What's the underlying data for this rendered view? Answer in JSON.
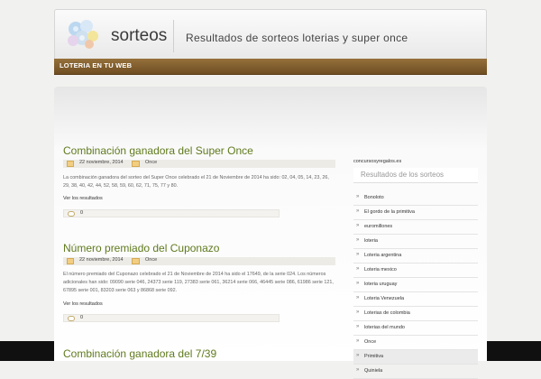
{
  "header": {
    "site_name": "sorteos",
    "tagline": "Resultados de sorteos loterias y super once"
  },
  "nav": {
    "items": [
      "LOTERIA EN TU WEB"
    ]
  },
  "posts": [
    {
      "title": "Combinación ganadora del Super Once",
      "date": "22 noviembre, 2014",
      "category": "Once",
      "excerpt": "La combinación ganadora del sorteo del Super Once celebrado el 21 de Noviembre de 2014 ha sido: 02, 04, 05, 14, 23, 26, 29, 38, 40, 42, 44, 52, 58, 59, 60, 62, 71, 75, 77 y 80.",
      "more": "Ver los resultados",
      "comments": "0"
    },
    {
      "title": "Número premiado del Cuponazo",
      "date": "22 noviembre, 2014",
      "category": "Once",
      "excerpt": "El número premiado del Cuponazo celebrado el 21 de Noviembre de 2014 ha sido el 17649, de la serie 024. Los números adicionales han sido: 09090 serie 046, 24373 serie 119, 27383 serie 061, 36214 serie 066, 46445 serie 086, 61986 serie 121, 67895 serie 001, 83203 serie 063 y 86868 serie 092.",
      "more": "Ver los resultados",
      "comments": "0"
    },
    {
      "title": "Combinación ganadora del 7/39"
    }
  ],
  "sidebar": {
    "note": "concursosyregalos.es",
    "heading": "Resultados de los sorteos",
    "items": [
      "Bonoloto",
      "El gordo de la primitiva",
      "euromillones",
      "loteria",
      "Loteria argentina",
      "Loteria mexico",
      "loteria uruguay",
      "Loteria Venezuela",
      "Loterias de colombia",
      "loterias del mundo",
      "Once",
      "Primitiva",
      "Quiniela"
    ],
    "active_index": 11
  },
  "colors": {
    "accent_green": "#5f7a1d",
    "nav_brown": "#7a5a2b"
  }
}
